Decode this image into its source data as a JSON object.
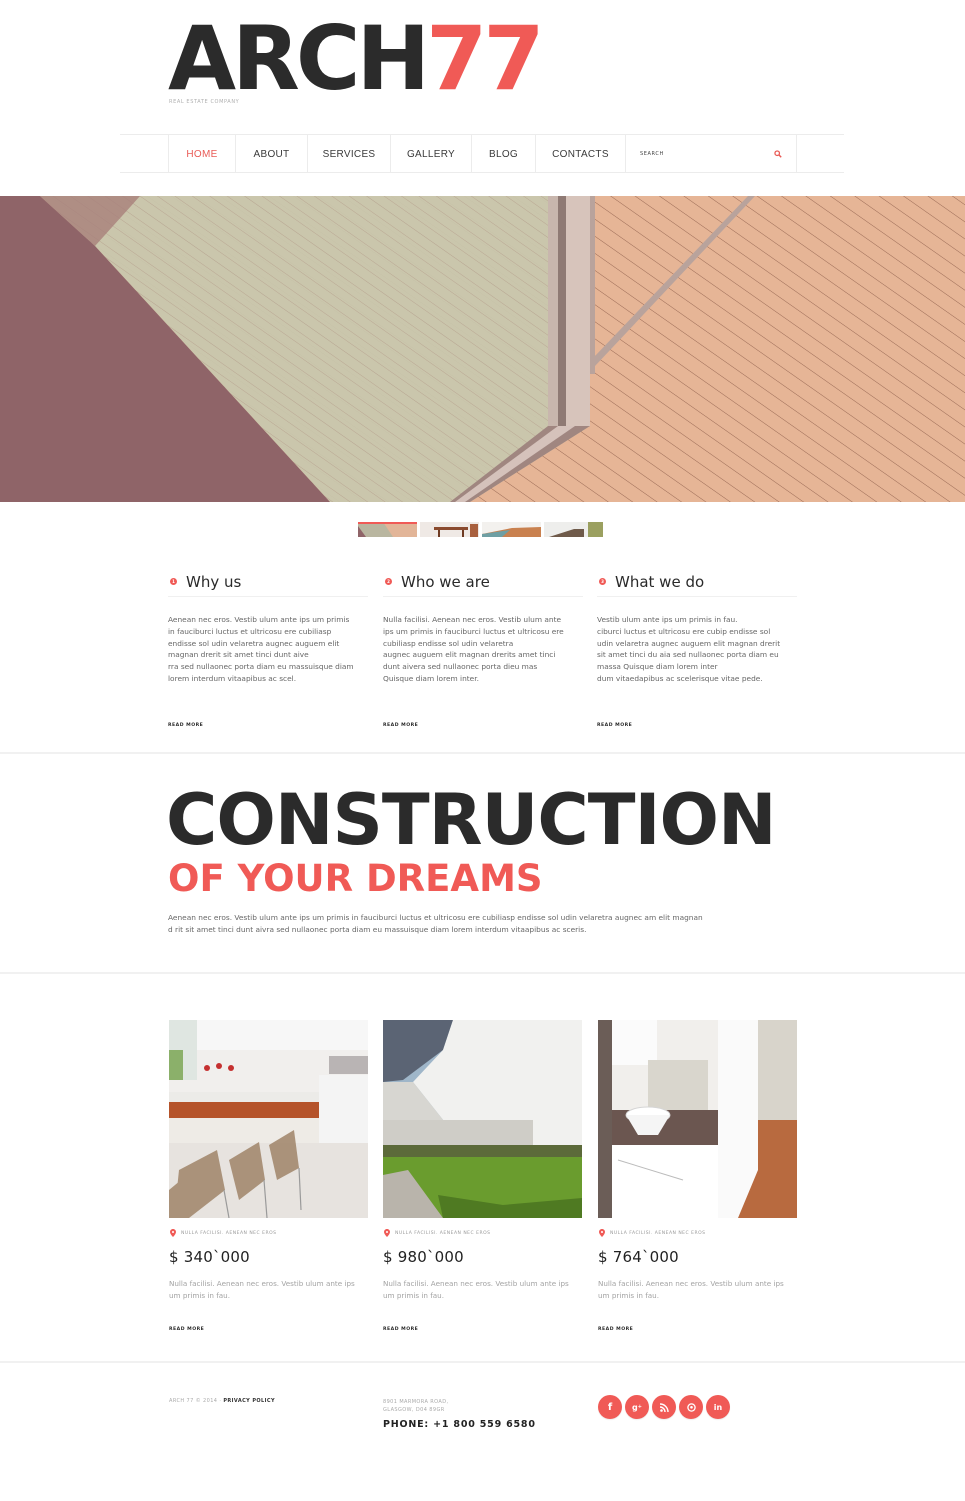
{
  "brand": {
    "name_main": "ARCH",
    "name_accent": "77",
    "tagline": "Real estate company",
    "accent_color": "#f05a56"
  },
  "nav": {
    "items": [
      {
        "label": "HOME",
        "active": true
      },
      {
        "label": "ABOUT",
        "active": false
      },
      {
        "label": "SERVICES",
        "active": false
      },
      {
        "label": "GALLERY",
        "active": false
      },
      {
        "label": "BLOG",
        "active": false
      },
      {
        "label": "CONTACTS",
        "active": false
      }
    ],
    "search_placeholder": "SEARCH",
    "search_icon": "magnifier-icon"
  },
  "hero": {
    "slide_count": 4,
    "active_slide": 1
  },
  "features": [
    {
      "number": "1",
      "title": "Why us",
      "text": "Aenean nec eros. Vestib ulum ante ips um primis\nin fauciburci luctus et ultricosu ere cubiliasp\nendisse sol udin velaretra augnec auguem elit\nmagnan drerit sit amet tinci dunt aive\nrra sed nullaonec porta diam eu massuisque diam\nlorem interdum vitaapibus ac scel.",
      "link": "Read more"
    },
    {
      "number": "2",
      "title": "Who we are",
      "text": "Nulla facilisi. Aenean nec eros. Vestib ulum ante\nips um primis in fauciburci luctus et ultricosu ere\ncubiliasp endisse sol udin velaretra\naugnec auguem elit magnan drerits amet tinci\ndunt aivera sed nullaonec porta dieu mas\n Quisque diam lorem inter.",
      "link": "Read more"
    },
    {
      "number": "3",
      "title": "What we do",
      "text": "Vestib ulum ante ips um primis in fau.\n ciburci luctus et ultricosu ere cubip endisse sol\nudin velaretra augnec auguem elit magnan drerit\nsit amet tinci du aia sed nullaonec porta diam eu\nmassa Quisque diam lorem inter\ndum vitaedapibus ac scelerisque vitae pede.",
      "link": "Read more"
    }
  ],
  "banner": {
    "title": "CONSTRUCTION",
    "subtitle": "OF YOUR DREAMS",
    "text": "Aenean nec eros. Vestib ulum ante ips um primis in fauciburci luctus et ultricosu ere cubiliasp endisse sol udin velaretra augnec am elit magnan d rit sit amet tinci dunt aivra sed nullaonec porta diam eu massuisque diam lorem interdum vitaapibus ac sceris."
  },
  "listings": [
    {
      "image": "kitchen-interior",
      "location": "Nulla facilisi. Aenean nec eros",
      "price": "$ 340`000",
      "text": "Nulla facilisi. Aenean nec eros. Vestib ulum ante ips um primis in fau.",
      "link": "Read more"
    },
    {
      "image": "courtyard-lawn",
      "location": "Nulla facilisi. Aenean nec eros",
      "price": "$ 980`000",
      "text": "Nulla facilisi. Aenean nec eros. Vestib ulum ante ips um primis in fau.",
      "link": "Read more"
    },
    {
      "image": "bathroom-interior",
      "location": "Nulla facilisi. Aenean nec eros",
      "price": "$ 764`000",
      "text": "Nulla facilisi. Aenean nec eros. Vestib ulum ante ips um primis in fau.",
      "link": "Read more"
    }
  ],
  "footer": {
    "copyright": "ARCH 77 © 2014 · ",
    "privacy_label": "PRIVACY POLICY",
    "address": "8901 MARMORA ROAD,\nGLASGOW, D04 89GR",
    "phone": "PHONE:  +1 800 559 6580",
    "socials": [
      {
        "name": "facebook",
        "glyph": "f"
      },
      {
        "name": "google-plus",
        "glyph": "g+"
      },
      {
        "name": "rss",
        "glyph": "rss"
      },
      {
        "name": "pinterest",
        "glyph": "p"
      },
      {
        "name": "linkedin",
        "glyph": "in"
      }
    ]
  }
}
